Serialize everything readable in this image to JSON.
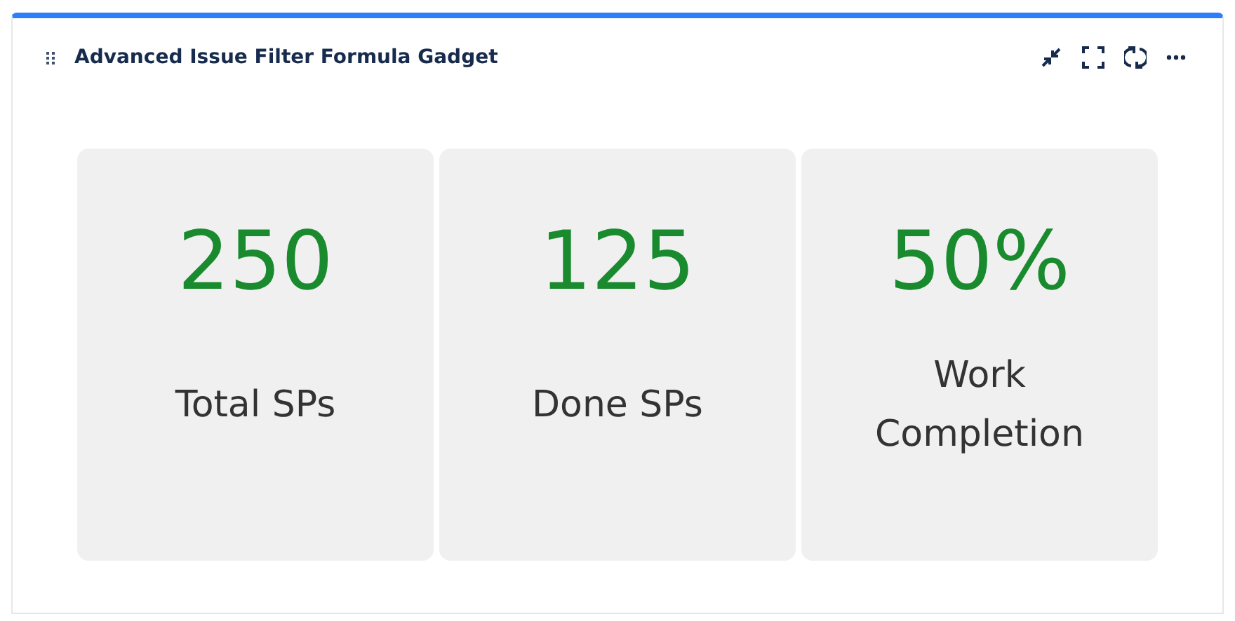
{
  "gadget": {
    "title": "Advanced Issue Filter Formula Gadget"
  },
  "metrics": [
    {
      "value": "250",
      "label": "Total SPs"
    },
    {
      "value": "125",
      "label": "Done SPs"
    },
    {
      "value": "50%",
      "label": "Work Completion"
    }
  ]
}
